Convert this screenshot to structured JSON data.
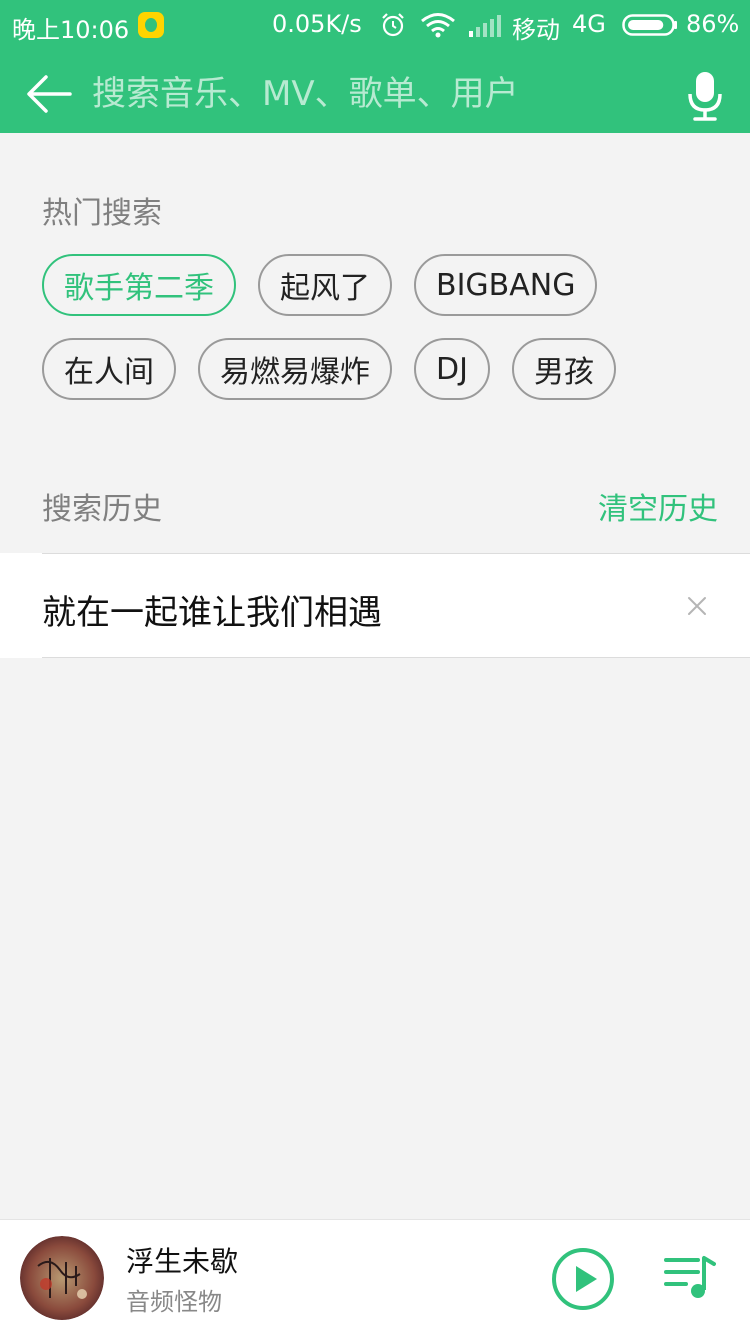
{
  "status_bar": {
    "time": "晚上10:06",
    "speed": "0.05K/s",
    "carrier": "移动",
    "network": "4G",
    "battery": "86%",
    "battery_level": 0.86
  },
  "search": {
    "placeholder": "搜索音乐、MV、歌单、用户",
    "value": ""
  },
  "hot_search": {
    "title": "热门搜索",
    "tags": [
      "歌手第二季",
      "起风了",
      "BIGBANG",
      "在人间",
      "易燃易爆炸",
      "DJ",
      "男孩"
    ]
  },
  "history": {
    "title": "搜索历史",
    "clear_label": "清空历史",
    "items": [
      "就在一起谁让我们相遇"
    ]
  },
  "player": {
    "song": "浮生未歇",
    "artist": "音频怪物"
  },
  "colors": {
    "accent": "#31c27c",
    "background": "#f3f3f3"
  }
}
